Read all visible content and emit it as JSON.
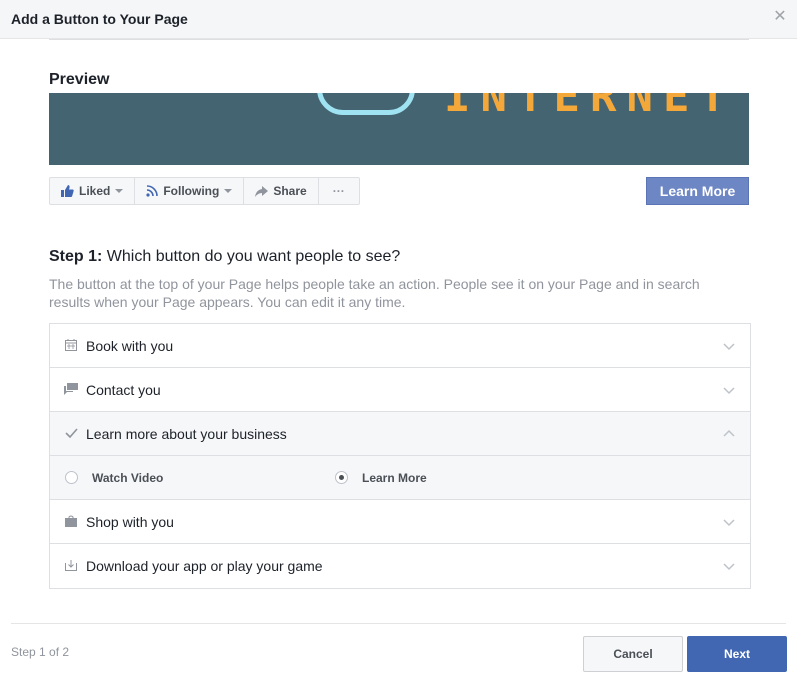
{
  "dialog": {
    "title": "Add a Button to Your Page",
    "close_icon": "close-icon"
  },
  "preview": {
    "label": "Preview",
    "cover_text": "INTERNET",
    "page_actions": [
      {
        "label": "Liked",
        "icon": "thumbs-up-icon",
        "has_dropdown": true
      },
      {
        "label": "Following",
        "icon": "rss-icon",
        "has_dropdown": true
      },
      {
        "label": "Share",
        "icon": "share-arrow-icon",
        "has_dropdown": false
      },
      {
        "label": "···",
        "icon": "more-icon",
        "has_dropdown": false
      }
    ],
    "cta_button": "Learn More"
  },
  "step": {
    "prefix": "Step 1:",
    "question": " Which button do you want people to see?",
    "description": "The button at the top of your Page helps people take an action. People see it on your Page and in search results when your Page appears. You can edit it any time."
  },
  "options": [
    {
      "label": "Book with you",
      "icon": "calendar-icon",
      "expanded": false
    },
    {
      "label": "Contact you",
      "icon": "chat-icon",
      "expanded": false
    },
    {
      "label": "Learn more about your business",
      "icon": "check-icon",
      "expanded": true,
      "choices": [
        {
          "label": "Watch Video",
          "selected": false
        },
        {
          "label": "Learn More",
          "selected": true
        }
      ]
    },
    {
      "label": "Shop with you",
      "icon": "shopping-bag-icon",
      "expanded": false
    },
    {
      "label": "Download your app or play your game",
      "icon": "download-icon",
      "expanded": false
    }
  ],
  "footer": {
    "step_count": "Step 1 of 2",
    "cancel": "Cancel",
    "next": "Next"
  }
}
